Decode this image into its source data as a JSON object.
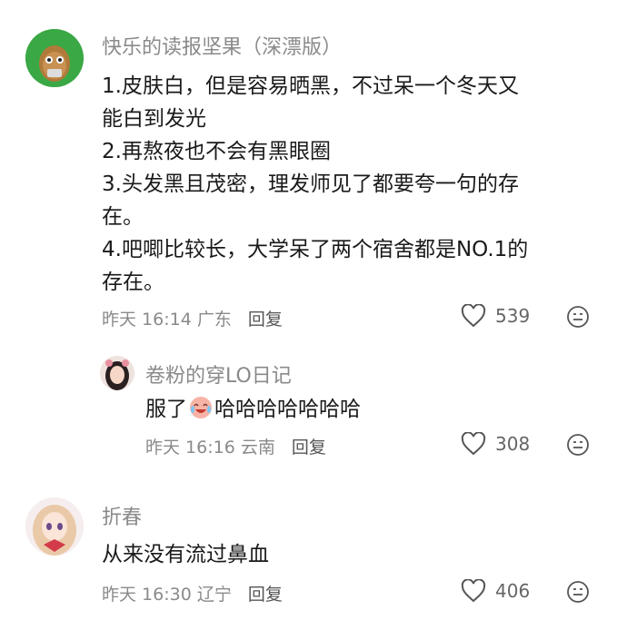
{
  "comments": [
    {
      "author": "快乐的读报坚果（深漂版）",
      "avatar": "wall-nut-avatar",
      "lines": [
        "1.皮肤白，但是容易晒黑，不过呆一个冬天又",
        "能白到发光",
        "2.再熬夜也不会有黑眼圈",
        "3.头发黑且茂密，理发师见了都要夸一句的存",
        "在。",
        "4.吧唧比较长，大学呆了两个宿舍都是NO.1的",
        "存在。"
      ],
      "time": "昨天 16:14",
      "location": "广东",
      "reply_label": "回复",
      "likes": "539"
    },
    {
      "author": "卷粉的穿LO日记",
      "avatar": "girl-avatar",
      "text_before": "服了",
      "emoji": "crying-laugh-emoji",
      "text_after": "哈哈哈哈哈哈哈",
      "time": "昨天 16:16",
      "location": "云南",
      "reply_label": "回复",
      "likes": "308"
    },
    {
      "author": "折春",
      "avatar": "anime-girl-avatar",
      "text": "从来没有流过鼻血",
      "time": "昨天 16:30",
      "location": "辽宁",
      "reply_label": "回复",
      "likes": "406"
    }
  ],
  "colors": {
    "meta": "#8a8a8a",
    "text": "#1a1a1a",
    "accent_green": "#3fa34d"
  }
}
